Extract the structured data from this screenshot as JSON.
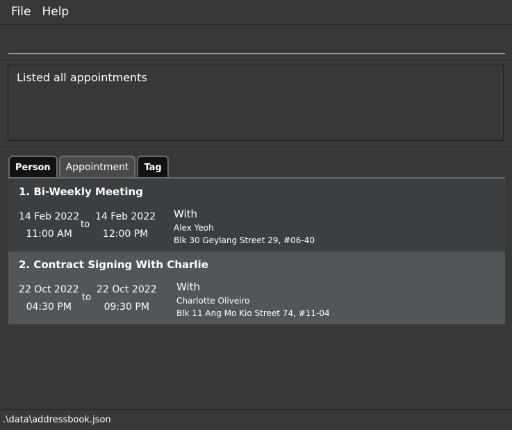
{
  "menu": {
    "file": "File",
    "help": "Help"
  },
  "command": {
    "value": "",
    "placeholder": ""
  },
  "result": {
    "text": "Listed all appointments"
  },
  "tabs": [
    {
      "label": "Person"
    },
    {
      "label": "Appointment"
    },
    {
      "label": "Tag"
    }
  ],
  "appointments": [
    {
      "title": "1.  Bi-Weekly Meeting",
      "start_date": "14 Feb 2022",
      "start_time": "11:00 AM",
      "to": "to",
      "end_date": "14 Feb 2022",
      "end_time": "12:00 PM",
      "with": "With",
      "person_name": "Alex Yeoh",
      "person_address": "Blk 30 Geylang Street 29, #06-40"
    },
    {
      "title": "2.  Contract Signing With Charlie",
      "start_date": "22 Oct 2022",
      "start_time": "04:30 PM",
      "to": "to",
      "end_date": "22 Oct 2022",
      "end_time": "09:30 PM",
      "with": "With",
      "person_name": "Charlotte Oliveiro",
      "person_address": "Blk 11 Ang Mo Kio Street 74, #11-04"
    }
  ],
  "status": {
    "file_path": ".\\data\\addressbook.json"
  }
}
